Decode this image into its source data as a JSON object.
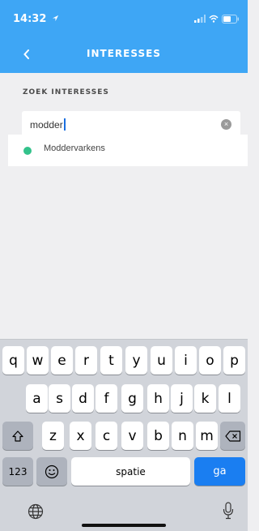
{
  "status_bar": {
    "time": "14:32"
  },
  "nav": {
    "title": "INTERESSES"
  },
  "search": {
    "section_label": "ZOEK INTERESSES",
    "value": "modder",
    "clear_glyph": "×"
  },
  "results": [
    {
      "label": "Moddervarkens",
      "dot_color": "#33c28b"
    }
  ],
  "keyboard": {
    "row1": [
      "q",
      "w",
      "e",
      "r",
      "t",
      "y",
      "u",
      "i",
      "o",
      "p"
    ],
    "row2": [
      "a",
      "s",
      "d",
      "f",
      "g",
      "h",
      "j",
      "k",
      "l"
    ],
    "row3": [
      "z",
      "x",
      "c",
      "v",
      "b",
      "n",
      "m"
    ],
    "numbers_label": "123",
    "space_label": "spatie",
    "return_label": "ga"
  },
  "colors": {
    "header": "#3ea6f5",
    "accent_key": "#1a7ef1",
    "background": "#efeff1"
  }
}
